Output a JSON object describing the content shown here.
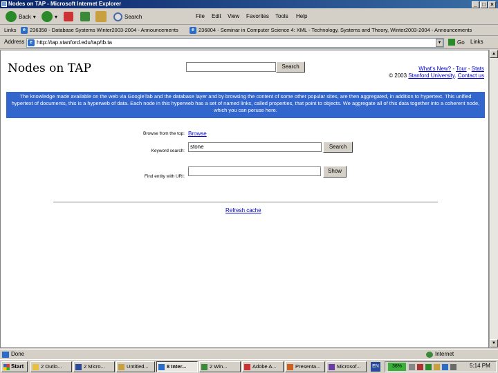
{
  "window": {
    "title": "Nodes on TAP - Microsoft Internet Explorer"
  },
  "toolbar": {
    "back": "Back",
    "search": "Search"
  },
  "menu": [
    "File",
    "Edit",
    "View",
    "Favorites",
    "Tools",
    "Help"
  ],
  "links_bar": {
    "label": "Links",
    "items": [
      "236358 - Database Systems Winter2003-2004 - Announcements",
      "236804 - Seminar in Computer Science 4: XML - Technology, Systems and Theory, Winter2003-2004 - Announcements"
    ]
  },
  "address": {
    "label": "Address",
    "value": "http://tap.stanford.edu/tap/tb.ta",
    "go": "Go",
    "links": "Links"
  },
  "page": {
    "title": "Nodes on TAP",
    "search_button": "Search",
    "links_line": [
      "What's New?",
      "Tour",
      "Stats"
    ],
    "copyright": "© 2003",
    "university": "Stanford University",
    "contact": "Contact us",
    "banner_text": "The knowledge made available on the web via GoogleTab and the database layer and by browsing the content of some other popular sites, are then aggregated, in addition to hypertext. This unified hypertext of documents, this is a hyperweb of data. Each node in this hyperweb has a set of named links, called properties, that point to objects. We aggregate all of this data together into a coherent node, which you can peruse here.",
    "browse_label": "Browse from the top:",
    "browse_link": "Browse",
    "keyword_label": "Keyword search:",
    "keyword_value": "stone",
    "keyword_button": "Search",
    "url_label": "Find entity with URI:",
    "url_value": "",
    "show_button": "Show",
    "refresh": "Refresh cache"
  },
  "status": {
    "left": "Done",
    "zone": "Internet"
  },
  "taskbar": {
    "start": "Start",
    "tasks": [
      "2 Outlo...",
      "2 Micro...",
      "Untitled...",
      "8 Inter...",
      "2 Win...",
      "Adobe A...",
      "Presenta...",
      "Microsof..."
    ],
    "lang": "EN",
    "battery": "36%",
    "clock": "5:14 PM"
  },
  "colors": {
    "banner": "#3366cc",
    "link": "#0000cc"
  }
}
